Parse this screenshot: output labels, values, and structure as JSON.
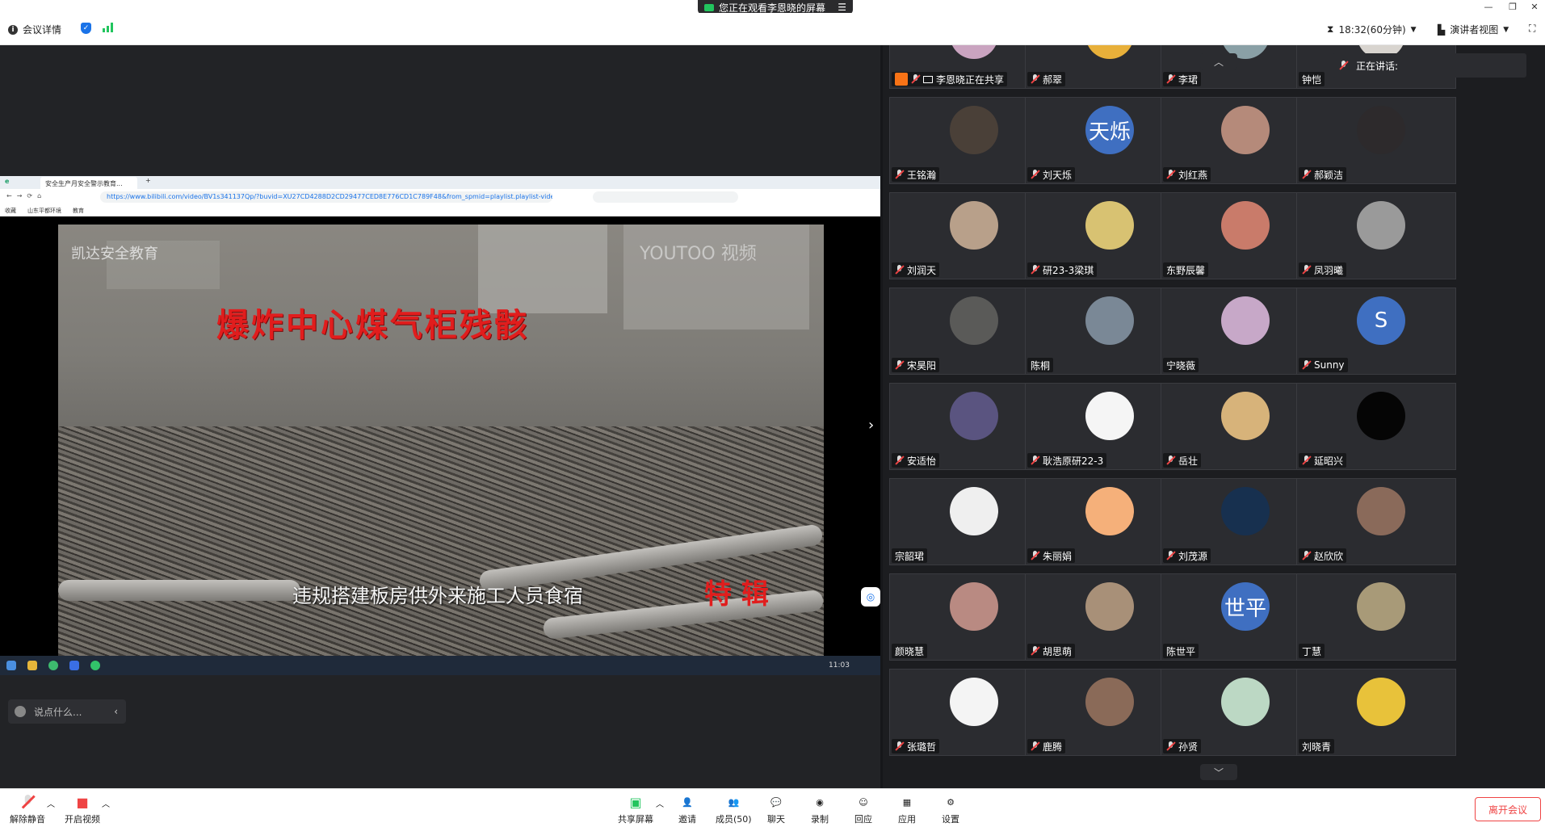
{
  "banner": {
    "text": "您正在观看李恩晓的屏幕"
  },
  "toolbar": {
    "meeting_info": "会议详情",
    "timer": "18:32(60分钟)",
    "view_mode": "演讲者视图"
  },
  "shared_screen": {
    "tab_title": "安全生产月安全警示教育...",
    "url": "https://www.bilibili.com/video/BV1s341137Qp/?buvid=XU27CD4288D2CD29477CED8E776CD1C789F48&from_spmid=playlist.playlist-video-det",
    "bookmarks": [
      "收藏",
      "山东平都环境",
      "教育"
    ],
    "video_watermark": "凯达安全教育",
    "video_watermark2": "YOUTOO 视频",
    "video_title": "爆炸中心煤气柜残骸",
    "video_caption": "违规搭建板房供外来施工人员食宿",
    "video_red_text": "特 辑",
    "taskbar_clock": "11:03"
  },
  "chat": {
    "placeholder": "说点什么..."
  },
  "speaking": {
    "label": "正在讲话:"
  },
  "participants": [
    {
      "name": "李恩晓正在共享",
      "avatar_color": "#caa4c0",
      "muted": true,
      "sharing": true
    },
    {
      "name": "郝翠",
      "avatar_color": "#e8b03a",
      "muted": true
    },
    {
      "name": "李珺",
      "avatar_color": "#8aa0a6",
      "muted": true
    },
    {
      "name": "钟恺",
      "avatar_color": "#d8d4cf",
      "muted": false
    },
    {
      "name": "王铭瀚",
      "avatar_color": "#4a4038",
      "muted": true
    },
    {
      "name": "刘天烁",
      "avatar_text": "天烁",
      "avatar_color": "#3f6fc1",
      "muted": true
    },
    {
      "name": "刘红燕",
      "avatar_color": "#b58a7a",
      "muted": true
    },
    {
      "name": "郝颖洁",
      "avatar_color": "#2d2a2c",
      "muted": true
    },
    {
      "name": "刘润天",
      "avatar_color": "#b8a08a",
      "muted": true
    },
    {
      "name": "研23-3梁琪",
      "avatar_color": "#d8c272",
      "muted": true
    },
    {
      "name": "东野辰馨",
      "avatar_color": "#c97b6a",
      "muted": false
    },
    {
      "name": "凤羽曦",
      "avatar_color": "#9a9a9a",
      "muted": true
    },
    {
      "name": "宋昊阳",
      "avatar_color": "#5a5a58",
      "muted": true
    },
    {
      "name": "陈桐",
      "avatar_color": "#7a8896",
      "muted": false
    },
    {
      "name": "宁晓薇",
      "avatar_color": "#c7a8c8",
      "muted": false
    },
    {
      "name": "Sunny",
      "avatar_text": "S",
      "avatar_color": "#3f6fc1",
      "muted": true
    },
    {
      "name": "安适怡",
      "avatar_color": "#5a5480",
      "muted": true
    },
    {
      "name": "耿浩原研22-3",
      "avatar_color": "#f5f5f5",
      "muted": true
    },
    {
      "name": "岳壮",
      "avatar_color": "#d7b37a",
      "muted": true
    },
    {
      "name": "延昭兴",
      "avatar_color": "#050505",
      "muted": true
    },
    {
      "name": "宗韶珺",
      "avatar_color": "#efefef",
      "muted": false
    },
    {
      "name": "朱丽娟",
      "avatar_color": "#f5b07a",
      "muted": true
    },
    {
      "name": "刘茂源",
      "avatar_color": "#17304f",
      "muted": true
    },
    {
      "name": "赵欣欣",
      "avatar_color": "#8a6a5a",
      "muted": true
    },
    {
      "name": "颜晓慧",
      "avatar_color": "#b98a82",
      "muted": false
    },
    {
      "name": "胡思萌",
      "avatar_color": "#a89078",
      "muted": true
    },
    {
      "name": "陈世平",
      "avatar_text": "世平",
      "avatar_color": "#3f6fc1",
      "muted": false
    },
    {
      "name": "丁慧",
      "avatar_color": "#a89a78",
      "muted": false
    },
    {
      "name": "张璐哲",
      "avatar_color": "#f4f4f4",
      "muted": true
    },
    {
      "name": "鹿腾",
      "avatar_color": "#8a6a58",
      "muted": true
    },
    {
      "name": "孙贤",
      "avatar_color": "#bcd8c4",
      "muted": true
    },
    {
      "name": "刘晓青",
      "avatar_color": "#e8c23a",
      "muted": false
    }
  ],
  "bottom_bar": {
    "unmute": "解除静音",
    "start_video": "开启视频",
    "share_screen": "共享屏幕",
    "invite": "邀请",
    "members": "成员(50)",
    "chat": "聊天",
    "record": "录制",
    "reaction": "回应",
    "apps": "应用",
    "settings": "设置",
    "leave": "离开会议"
  }
}
